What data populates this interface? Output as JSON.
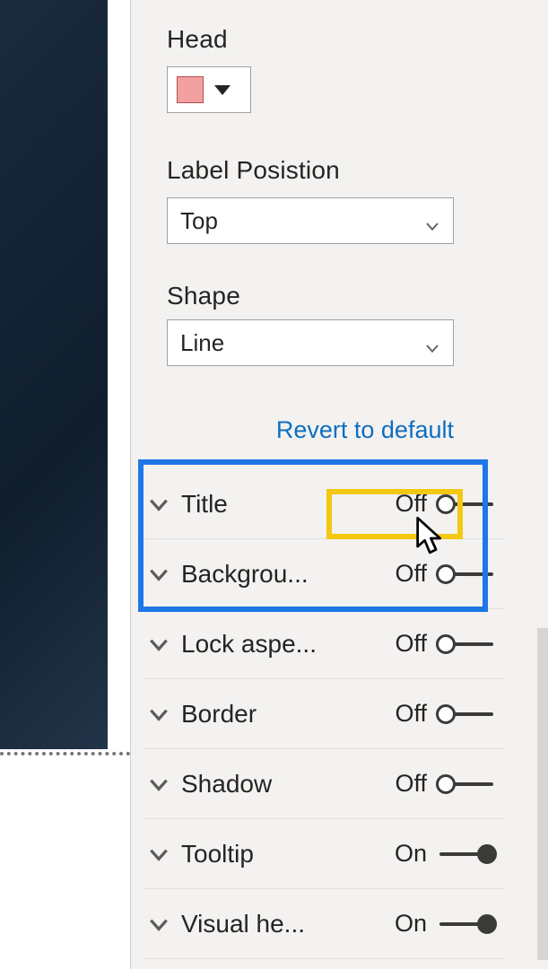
{
  "colors": {
    "head_swatch": "#f3a0a0"
  },
  "fields": {
    "head_label": "Head",
    "label_position_label": "Label Posistion",
    "label_position_value": "Top",
    "shape_label": "Shape",
    "shape_value": "Line"
  },
  "actions": {
    "revert": "Revert to default"
  },
  "toggle_text": {
    "on": "On",
    "off": "Off"
  },
  "sections": [
    {
      "label": "Title",
      "state": "off",
      "highlight": true
    },
    {
      "label": "Backgrou...",
      "state": "off",
      "highlight": false
    },
    {
      "label": "Lock aspe...",
      "state": "off",
      "highlight": false
    },
    {
      "label": "Border",
      "state": "off",
      "highlight": false
    },
    {
      "label": "Shadow",
      "state": "off",
      "highlight": false
    },
    {
      "label": "Tooltip",
      "state": "on",
      "highlight": false
    },
    {
      "label": "Visual he...",
      "state": "on",
      "highlight": false
    }
  ]
}
